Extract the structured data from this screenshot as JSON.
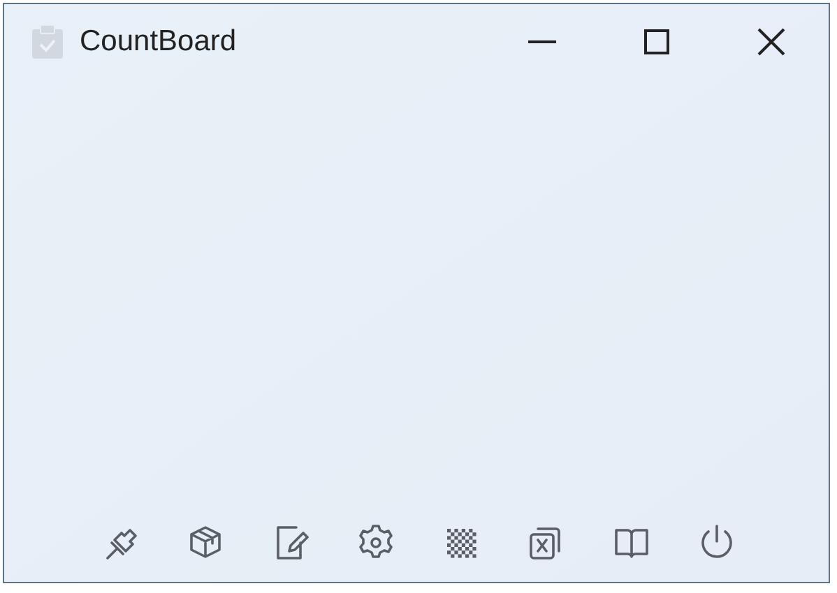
{
  "window": {
    "title": "CountBoard"
  },
  "toolbar": [
    {
      "kind": "pin"
    },
    {
      "kind": "box"
    },
    {
      "kind": "edit"
    },
    {
      "kind": "settings"
    },
    {
      "kind": "checker"
    },
    {
      "kind": "close-copy"
    },
    {
      "kind": "book"
    },
    {
      "kind": "power"
    }
  ]
}
